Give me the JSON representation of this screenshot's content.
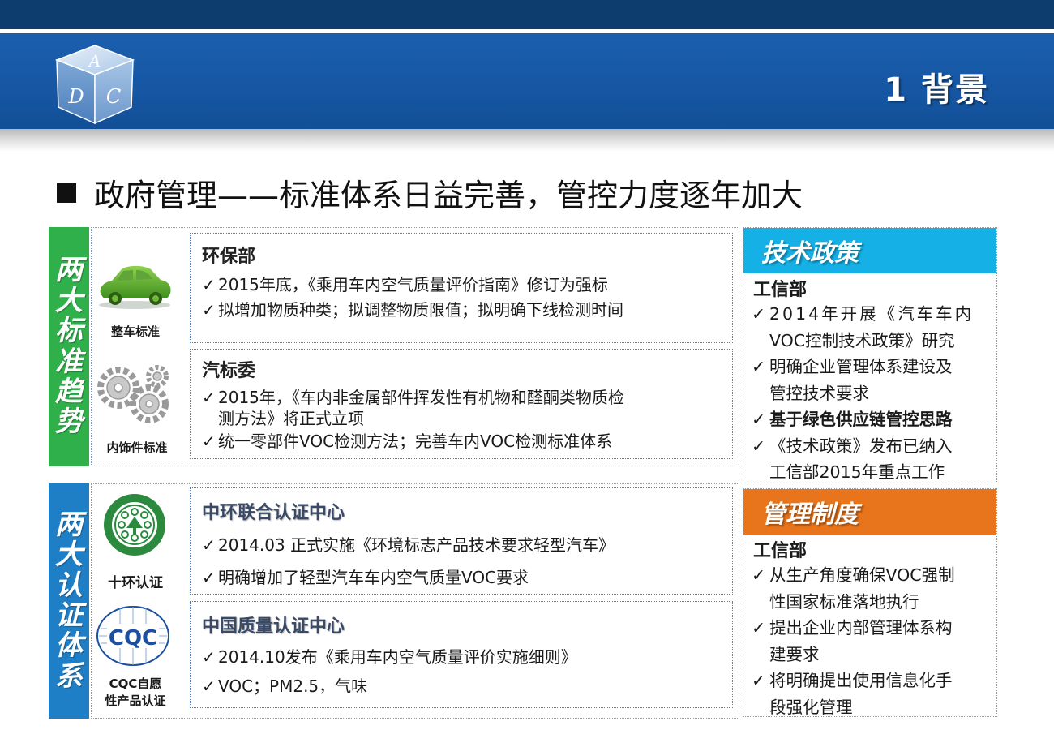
{
  "header": {
    "title": "1 背景",
    "logo_letters": [
      "A",
      "D",
      "C"
    ]
  },
  "main": {
    "heading": "政府管理——标准体系日益完善，管控力度逐年加大"
  },
  "section_standards": {
    "tab_label": [
      "两",
      "大",
      "标",
      "准",
      "趋",
      "势"
    ],
    "icons": [
      {
        "label": "整车标准",
        "icon": "car-icon"
      },
      {
        "label": "内饰件标准",
        "icon": "gears-icon"
      }
    ],
    "boxes": [
      {
        "title": "环保部",
        "items": [
          {
            "check": "✓",
            "text": "2015年底，《乘用车内空气质量评价指南》修订为强标"
          },
          {
            "check": "✓",
            "text": "拟增加物质种类；拟调整物质限值；拟明确下线检测时间"
          }
        ]
      },
      {
        "title": "汽标委",
        "items": [
          {
            "check": "✓",
            "text": "2015年，《车内非金属部件挥发性有机物和醛酮类物质检"
          },
          {
            "check": "",
            "text": "测方法》将正式立项"
          },
          {
            "check": "✓",
            "text": "统一零部件VOC检测方法；完善车内VOC检测标准体系"
          }
        ]
      }
    ]
  },
  "section_certification": {
    "tab_label": [
      "两",
      "大",
      "认",
      "证",
      "体",
      "系"
    ],
    "icons": [
      {
        "label": "十环认证",
        "icon": "ten-ring-logo-icon"
      },
      {
        "label": "CQC自愿",
        "label2": "性产品认证",
        "icon": "cqc-logo-icon",
        "logo_text": "CQC"
      }
    ],
    "boxes": [
      {
        "title": "中环联合认证中心",
        "items": [
          {
            "check": "✓",
            "text": " 2014.03 正式实施《环境标志产品技术要求轻型汽车》"
          },
          {
            "check": "✓",
            "text": "明确增加了轻型汽车车内空气质量VOC要求"
          }
        ]
      },
      {
        "title": "中国质量认证中心",
        "items": [
          {
            "check": "✓",
            "text": "  2014.10发布《乘用车内空气质量评价实施细则》"
          },
          {
            "check": "✓",
            "text": " VOC；PM2.5，气味"
          }
        ]
      }
    ]
  },
  "tech_policy": {
    "header": "技术政策",
    "subtitle": "工信部",
    "items": [
      {
        "check": "✓",
        "text": "2014年开展《汽车车内",
        "bold": false
      },
      {
        "check": "",
        "text": "VOC控制技术政策》研究",
        "bold": false
      },
      {
        "check": "✓",
        "text": "明确企业管理体系建设及",
        "bold": false
      },
      {
        "check": "",
        "text": "管控技术要求",
        "bold": false
      },
      {
        "check": "✓",
        "text": "基于绿色供应链管控思路",
        "bold": true
      },
      {
        "check": "✓",
        "text": "《技术政策》发布已纳入",
        "bold": false
      },
      {
        "check": "",
        "text": "工信部2015年重点工作",
        "bold": false
      }
    ]
  },
  "mgmt_system": {
    "header": "管理制度",
    "subtitle": "工信部",
    "items": [
      {
        "check": "✓",
        "text": "从生产角度确保VOC强制"
      },
      {
        "check": "",
        "text": "性国家标准落地执行"
      },
      {
        "check": "✓",
        "text": "提出企业内部管理体系构"
      },
      {
        "check": "",
        "text": "建要求"
      },
      {
        "check": "✓",
        "text": "将明确提出使用信息化手"
      },
      {
        "check": "",
        "text": "段强化管理"
      }
    ]
  },
  "colors": {
    "top_bar": "#0d3c6e",
    "header_blue": "#1657a4",
    "green_tab": "#2fb04a",
    "blue_tab": "#1f7fc6",
    "cyan_header": "#15b1e6",
    "orange_header": "#e8741b"
  }
}
